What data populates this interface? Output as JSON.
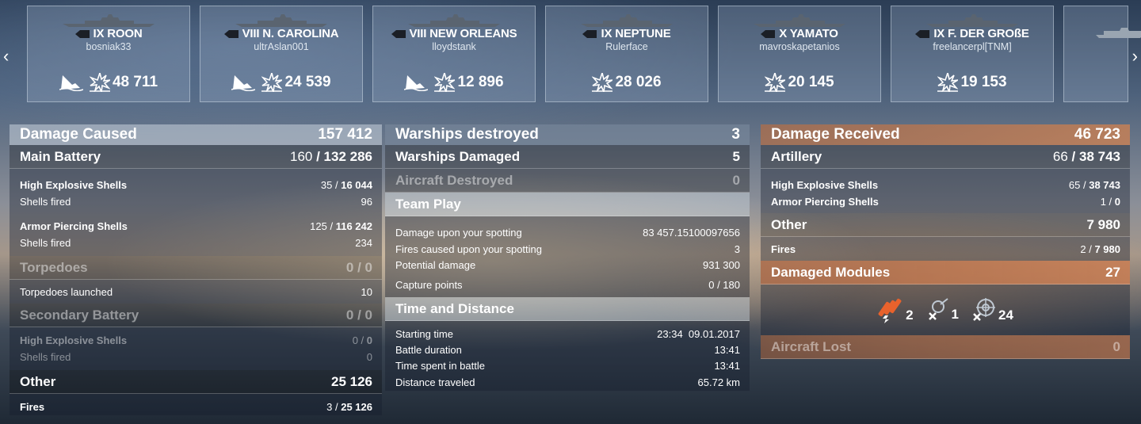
{
  "nav": {
    "prev": "‹",
    "next": "›"
  },
  "ships": [
    {
      "name": "IX ROON",
      "player": "bosniak33",
      "show_sunk": true,
      "damage": "48 711"
    },
    {
      "name": "VIII N. CAROLINA",
      "player": "ultrAslan001",
      "show_sunk": true,
      "damage": "24 539"
    },
    {
      "name": "VIII NEW ORLEANS",
      "player": "lloydstank",
      "show_sunk": true,
      "damage": "12 896"
    },
    {
      "name": "IX NEPTUNE",
      "player": "Rulerface",
      "show_sunk": false,
      "damage": "28 026"
    },
    {
      "name": "X YAMATO",
      "player": "mavroskapetanios",
      "show_sunk": false,
      "damage": "20 145"
    },
    {
      "name": "IX F. DER GROßE",
      "player": "freelancerpl[TNM]",
      "show_sunk": false,
      "damage": "19 153"
    }
  ],
  "left": {
    "damage_caused": {
      "label": "Damage Caused",
      "value": "157 412"
    },
    "main_battery": {
      "label": "Main Battery",
      "hits": "160",
      "dmg": "132 286"
    },
    "he": {
      "label": "High Explosive Shells",
      "hits": "35",
      "dmg": "16 044"
    },
    "he_fired": {
      "label": "Shells fired",
      "value": "96"
    },
    "ap": {
      "label": "Armor Piercing Shells",
      "hits": "125",
      "dmg": "116 242"
    },
    "ap_fired": {
      "label": "Shells fired",
      "value": "234"
    },
    "torpedoes": {
      "label": "Torpedoes",
      "value": "0 / 0"
    },
    "torp_launched": {
      "label": "Torpedoes launched",
      "value": "10"
    },
    "secondary": {
      "label": "Secondary Battery",
      "value": "0 / 0"
    },
    "sec_he": {
      "label": "High Explosive Shells",
      "hits": "0",
      "dmg": "0"
    },
    "sec_fired": {
      "label": "Shells fired",
      "value": "0"
    },
    "other": {
      "label": "Other",
      "value": "25 126"
    },
    "fires": {
      "label": "Fires",
      "hits": "3",
      "dmg": "25 126"
    }
  },
  "mid": {
    "destroyed": {
      "label": "Warships destroyed",
      "value": "3"
    },
    "damaged": {
      "label": "Warships Damaged",
      "value": "5"
    },
    "aircraft": {
      "label": "Aircraft Destroyed",
      "value": "0"
    },
    "team_play": {
      "label": "Team Play"
    },
    "spot_dmg": {
      "label": "Damage upon your spotting",
      "value": "83 457.15100097656"
    },
    "spot_fires": {
      "label": "Fires caused upon your spotting",
      "value": "3"
    },
    "potential": {
      "label": "Potential damage",
      "value": "931 300"
    },
    "capture": {
      "label": "Capture points",
      "value": "0 / 180"
    },
    "time_distance": {
      "label": "Time and Distance"
    },
    "start": {
      "label": "Starting time",
      "value": "23:34  09.01.2017"
    },
    "duration": {
      "label": "Battle duration",
      "value": "13:41"
    },
    "time_spent": {
      "label": "Time spent in battle",
      "value": "13:41"
    },
    "distance": {
      "label": "Distance traveled",
      "value": "65.72 km"
    }
  },
  "right": {
    "received": {
      "label": "Damage Received",
      "value": "46 723"
    },
    "artillery": {
      "label": "Artillery",
      "hits": "66",
      "dmg": "38 743"
    },
    "he": {
      "label": "High Explosive Shells",
      "hits": "65",
      "dmg": "38 743"
    },
    "ap": {
      "label": "Armor Piercing Shells",
      "hits": "1",
      "dmg": "0"
    },
    "other": {
      "label": "Other",
      "value": "7 980"
    },
    "fires": {
      "label": "Fires",
      "hits": "2",
      "dmg": "7 980"
    },
    "modules": {
      "label": "Damaged Modules",
      "value": "27"
    },
    "module_counts": {
      "engine": "2",
      "turret": "1",
      "fire_control": "24"
    },
    "aircraft_lost": {
      "label": "Aircraft Lost",
      "value": "0"
    }
  }
}
